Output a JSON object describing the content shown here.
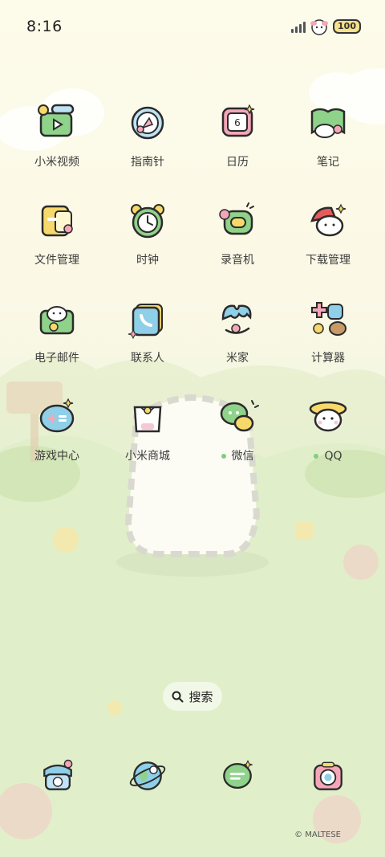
{
  "status": {
    "time": "8:16",
    "battery": "100"
  },
  "apps": [
    {
      "label": "小米视频",
      "icon": "video-icon"
    },
    {
      "label": "指南针",
      "icon": "compass-icon"
    },
    {
      "label": "日历",
      "icon": "calendar-icon",
      "badge": "6"
    },
    {
      "label": "笔记",
      "icon": "notes-icon"
    },
    {
      "label": "文件管理",
      "icon": "folder-icon"
    },
    {
      "label": "时钟",
      "icon": "clock-icon"
    },
    {
      "label": "录音机",
      "icon": "recorder-icon"
    },
    {
      "label": "下载管理",
      "icon": "download-icon"
    },
    {
      "label": "电子邮件",
      "icon": "email-icon"
    },
    {
      "label": "联系人",
      "icon": "contacts-icon"
    },
    {
      "label": "米家",
      "icon": "mijia-icon"
    },
    {
      "label": "计算器",
      "icon": "calculator-icon"
    },
    {
      "label": "游戏中心",
      "icon": "gamepad-icon"
    },
    {
      "label": "小米商城",
      "icon": "shopping-bag-icon"
    },
    {
      "label": "微信",
      "icon": "wechat-icon",
      "new": true
    },
    {
      "label": "QQ",
      "icon": "qq-icon",
      "new": true
    }
  ],
  "search": {
    "label": "搜索"
  },
  "dock": [
    {
      "icon": "phone-icon"
    },
    {
      "icon": "browser-icon"
    },
    {
      "icon": "messages-icon"
    },
    {
      "icon": "camera-icon"
    }
  ],
  "credit": "© MALTESE",
  "colors": {
    "accent": "#7fcf82",
    "outline": "#2b2b2b"
  }
}
